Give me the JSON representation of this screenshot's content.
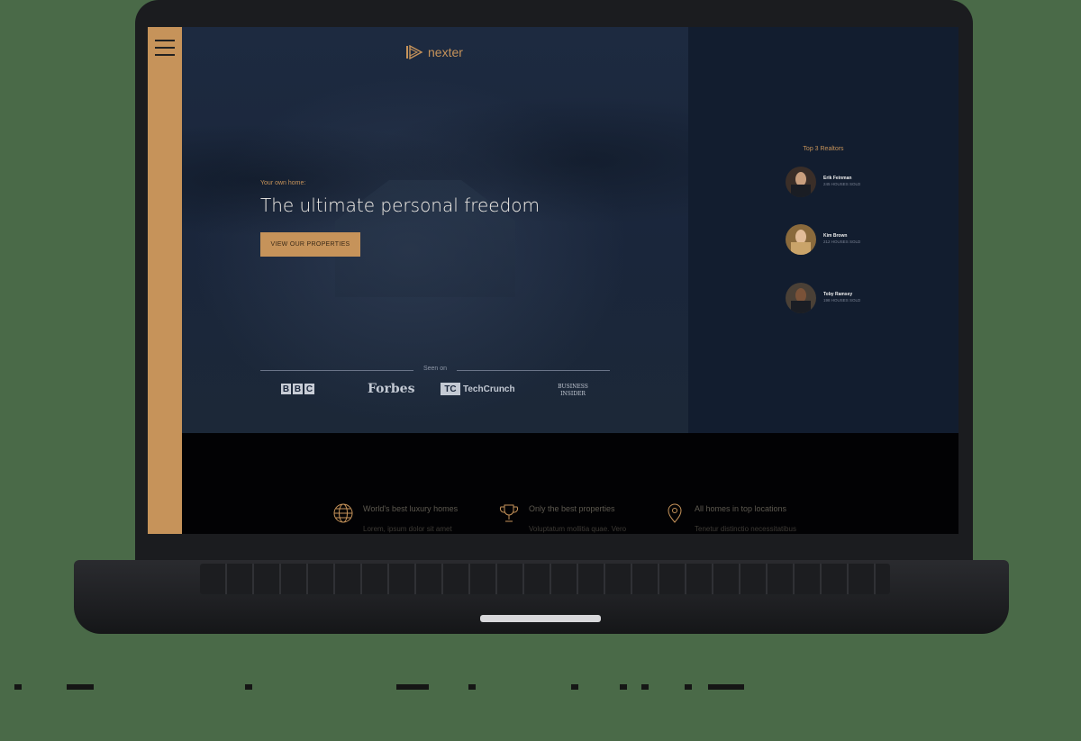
{
  "brand": {
    "name": "nexter",
    "accent": "#c6935a"
  },
  "hero": {
    "eyebrow": "Your own home:",
    "headline": "The ultimate personal freedom",
    "cta_label": "VIEW OUR PROPERTIES"
  },
  "seen_on": {
    "label": "Seen on",
    "logos": [
      "BBC",
      "Forbes",
      "TechCrunch",
      "BUSINESS INSIDER"
    ]
  },
  "realtors": {
    "title": "Top 3 Realtors",
    "items": [
      {
        "name": "Erik Feinman",
        "sold": "245 HOUSES SOLD"
      },
      {
        "name": "Kim Brown",
        "sold": "212 HOUSES SOLD"
      },
      {
        "name": "Toby Ramsey",
        "sold": "198 HOUSES SOLD"
      }
    ]
  },
  "features": [
    {
      "icon": "globe-icon",
      "title": "World's best luxury homes",
      "text": "Lorem, ipsum dolor sit amet"
    },
    {
      "icon": "trophy-icon",
      "title": "Only the best properties",
      "text": "Voluptatum mollitia quae. Vero"
    },
    {
      "icon": "map-pin-icon",
      "title": "All homes in top locations",
      "text": "Tenetur distinctio necessitatibus"
    }
  ],
  "colors": {
    "hero_bg": "#1a263b",
    "realtor_panel_bg": "#121d2f",
    "sidebar": "#c6935a"
  }
}
